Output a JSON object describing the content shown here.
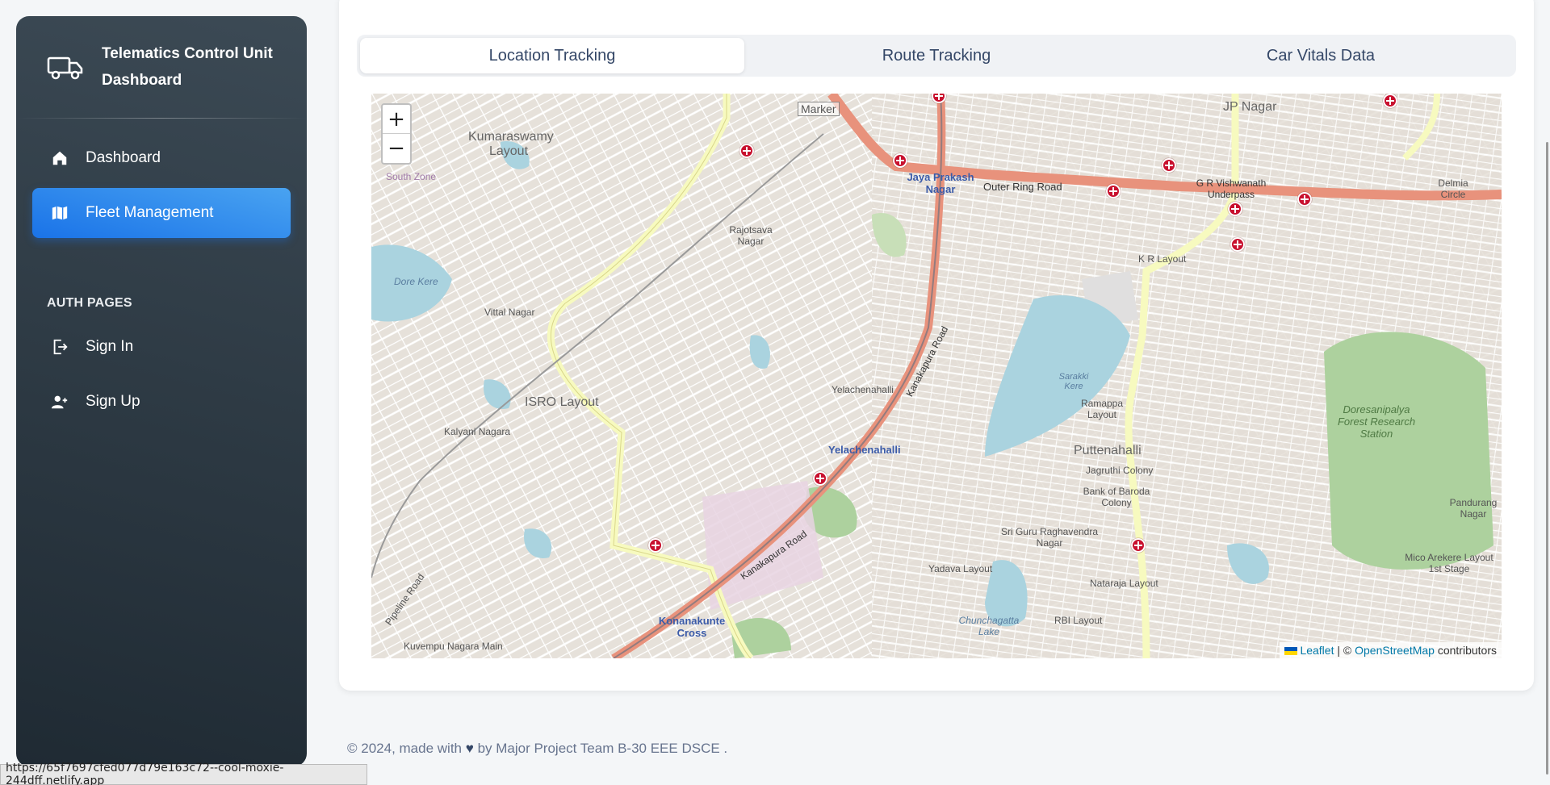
{
  "brand": {
    "title": "Telematics Control Unit Dashboard",
    "icon": "truck-icon"
  },
  "sidebar": {
    "items": [
      {
        "label": "Dashboard",
        "icon": "home-icon",
        "active": false
      },
      {
        "label": "Fleet Management",
        "icon": "map-icon",
        "active": true
      }
    ],
    "section_title": "AUTH PAGES",
    "auth_items": [
      {
        "label": "Sign In",
        "icon": "sign-in-icon"
      },
      {
        "label": "Sign Up",
        "icon": "user-plus-icon"
      }
    ]
  },
  "tabs": [
    {
      "label": "Location Tracking",
      "active": true
    },
    {
      "label": "Route Tracking",
      "active": false
    },
    {
      "label": "Car Vitals Data",
      "active": false
    }
  ],
  "map": {
    "zoom_in": "+",
    "zoom_out": "−",
    "marker_label": "Marker",
    "attribution": {
      "leaflet": "Leaflet",
      "separator": " | © ",
      "osm": "OpenStreetMap",
      "suffix": " contributors"
    },
    "labels": {
      "kumaraswamy": "Kumaraswamy Layout",
      "rajotsava": "Rajotsava Nagar",
      "jp_nagar": "JP Nagar",
      "jaya_prakash": "Jaya Prakash Nagar",
      "outer_ring": "Outer Ring Road",
      "gr_underpass": "G R Vishwanath Underpass",
      "delmia": "Delmia Circle",
      "kr_layout": "K R Layout",
      "vittal": "Vittal Nagar",
      "dore_kere": "Dore Kere",
      "isro": "ISRO Layout",
      "kalyani": "Kalyani Nagara",
      "yelachenahalli_1": "Yelachenahalli",
      "yelachenahalli_2": "Yelachenahalli",
      "sarakki": "Sarakki Kere",
      "ramappa": "Ramappa Layout",
      "puttenahalli": "Puttenahalli",
      "jagruthi": "Jagruthi Colony",
      "bob_colony": "Bank of Baroda Colony",
      "doresanipalya": "Doresanipalya Forest Research Station",
      "pandurang": "Pandurang Nagar",
      "sri_guru": "Sri Guru Raghavendra Nagar",
      "yadava": "Yadava Layout",
      "nataraja": "Nataraja Layout",
      "rbi": "RBI Layout",
      "chunchaghatta": "Chunchagatta Lake",
      "konanakunte": "Konanakunte Cross",
      "mico": "Mico Arekere Layout 1st Stage",
      "kanakapura": "Kanakapura Road",
      "south_zone": "South Zone",
      "kuvempu": "Kuvempu Nagara Main",
      "pipeline": "Pipeline Road"
    }
  },
  "footer": {
    "prefix": "© 2024, made with",
    "suffix": "by Major Project Team B-30 EEE DSCE ."
  },
  "status_url": "https://65f7697cfed077d79e163c72--cool-moxie-244dff.netlify.app",
  "colors": {
    "accent": "#1a73e8",
    "sidebar": "#2a3640",
    "marker": "#c8102e",
    "major_road": "#e8927c"
  }
}
